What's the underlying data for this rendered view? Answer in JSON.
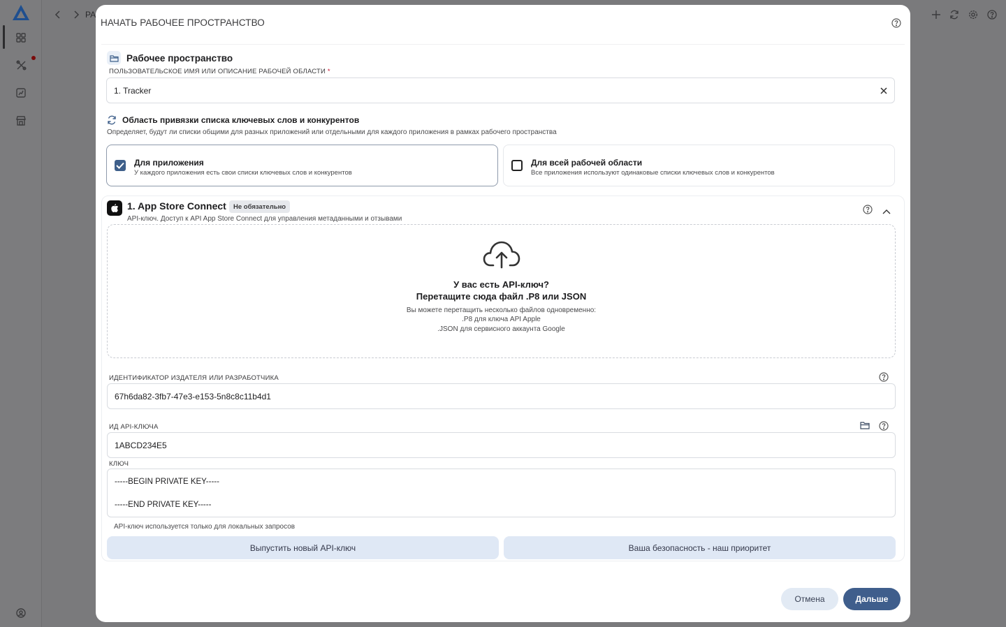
{
  "background": {
    "breadcrumb_fragment": "PA"
  },
  "modal": {
    "title": "НАЧАТЬ РАБОЧЕЕ ПРОСТРАНСТВО",
    "workspace": {
      "heading": "Рабочее пространство",
      "name_label": "ПОЛЬЗОВАТЕЛЬСКОЕ ИМЯ ИЛИ ОПИСАНИЕ РАБОЧЕЙ ОБЛАСТИ",
      "required_mark": "*",
      "name_value": "1. Tracker"
    },
    "scope": {
      "heading": "Область привязки списка ключевых слов и конкурентов",
      "description": "Определяет, будут ли списки общими для разных приложений или отдельными для каждого приложения в рамках рабочего пространства",
      "options": [
        {
          "title": "Для приложения",
          "subtitle": "У каждого приложения есть свои списки ключевых слов и конкурентов",
          "checked": true
        },
        {
          "title": "Для всей рабочей области",
          "subtitle": "Все приложения используют одинаковые списки ключевых слов и конкурентов",
          "checked": false
        }
      ]
    },
    "app_store": {
      "title": "1. App Store Connect",
      "badge": "Не обязательно",
      "subtitle": "API-ключ. Доступ к API App Store Connect для управления метаданными и отзывами",
      "dropzone": {
        "question": "У вас есть API-ключ?",
        "instruction": "Перетащите сюда файл .P8 или JSON",
        "hint_1": "Вы можете перетащить несколько файлов одновременно:",
        "hint_2": ".P8 для ключа API Apple",
        "hint_3": ".JSON для сервисного аккаунта Google"
      },
      "issuer_label": "ИДЕНТИФИКАТОР ИЗДАТЕЛЯ ИЛИ РАЗРАБОТЧИКА",
      "issuer_value": "67h6da82-3fb7-47e3-e153-5n8c8c11b4d1",
      "key_id_label": "ИД API-КЛЮЧА",
      "key_id_value": "1ABCD234E5",
      "key_label": "КЛЮЧ",
      "key_line_1": "-----BEGIN PRIVATE KEY-----",
      "key_line_2": "-----END PRIVATE KEY-----",
      "key_note": "API-ключ используется только для локальных запросов",
      "issue_button": "Выпустить новый API-ключ",
      "security_button": "Ваша безопасность - наш приоритет"
    },
    "footer": {
      "cancel": "Отмена",
      "next": "Дальше"
    }
  },
  "colors": {
    "accent": "#3f5e8c",
    "secondary_button": "#dfe8f5",
    "checkbox_checked": "#3e5f8a",
    "required": "#c8102e"
  },
  "icons": [
    "logo-icon",
    "back-icon",
    "forward-icon",
    "grid-icon",
    "tools-icon",
    "chart-icon",
    "store-icon",
    "user-icon",
    "plus-icon",
    "refresh-icon",
    "gear-icon",
    "help-icon",
    "folder-icon",
    "close-icon",
    "apple-icon",
    "chevron-up-icon",
    "cloud-upload-icon"
  ]
}
